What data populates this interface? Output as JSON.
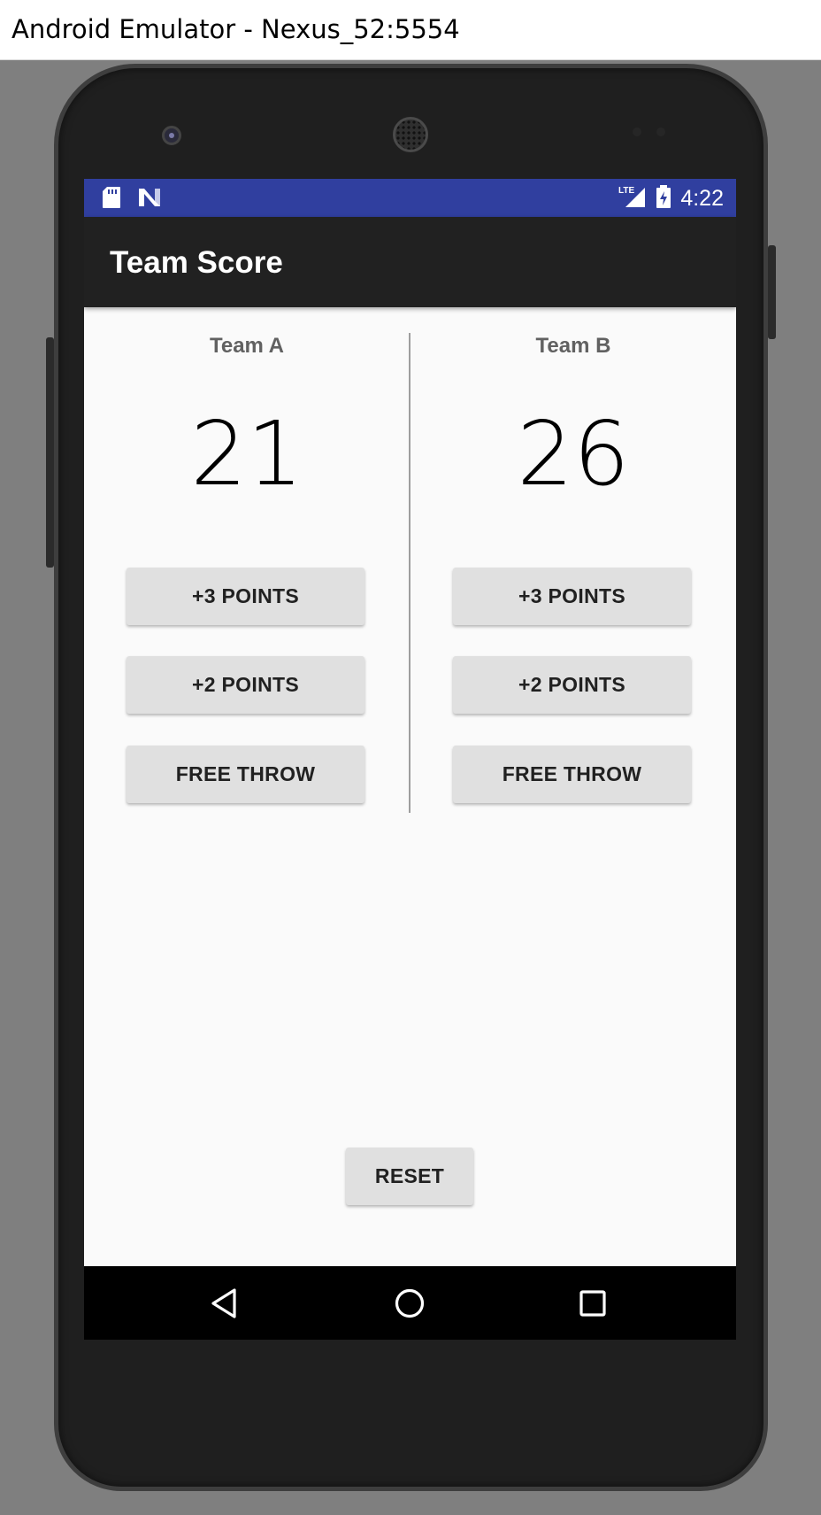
{
  "window": {
    "title": "Android Emulator - Nexus_52:5554"
  },
  "status_bar": {
    "time": "4:22",
    "network": "LTE",
    "icons": [
      "sd-card-icon",
      "n-notification-icon",
      "lte-signal-icon",
      "battery-icon"
    ],
    "color": "#303f9f"
  },
  "app_bar": {
    "title": "Team Score",
    "color": "#212121"
  },
  "teams": [
    {
      "name": "Team A",
      "score": "21",
      "buttons": [
        "+3 POINTS",
        "+2 POINTS",
        "FREE THROW"
      ]
    },
    {
      "name": "Team B",
      "score": "26",
      "buttons": [
        "+3 POINTS",
        "+2 POINTS",
        "FREE THROW"
      ]
    }
  ],
  "reset_label": "RESET",
  "nav_bar": {
    "icons": [
      "back-icon",
      "home-icon",
      "recents-icon"
    ]
  }
}
